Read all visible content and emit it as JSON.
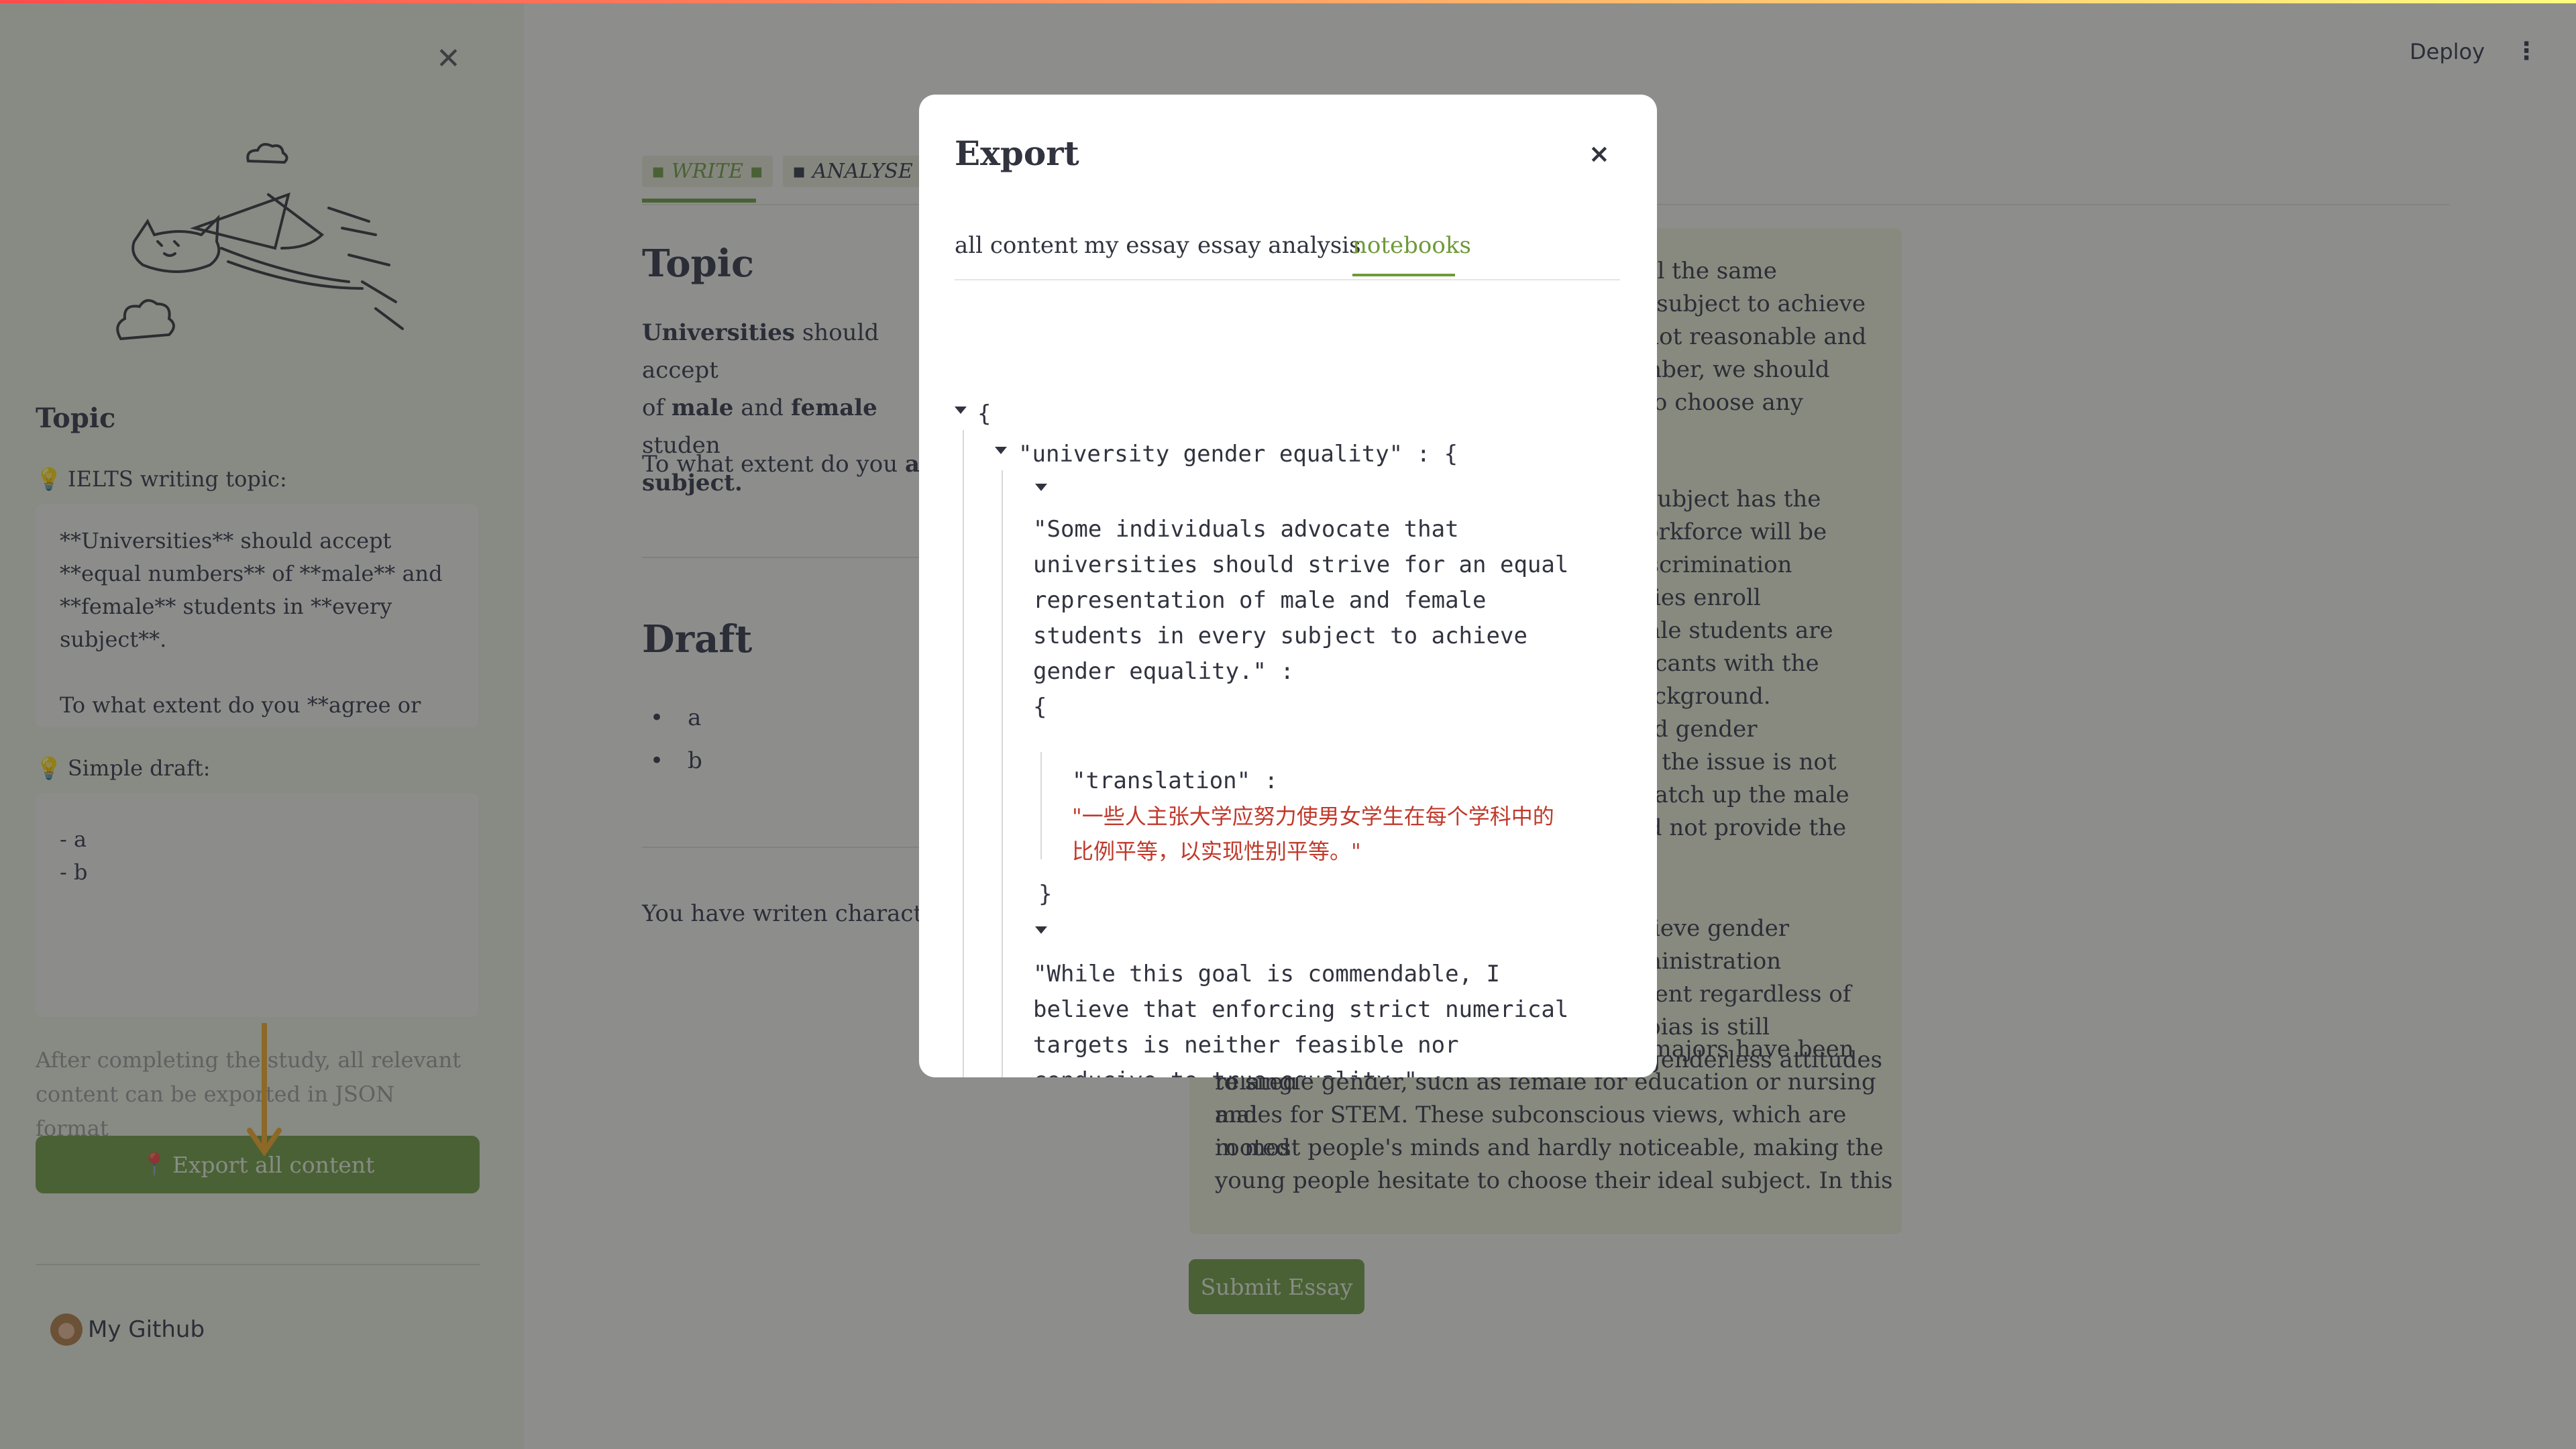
{
  "sidebar": {
    "close_icon": "close-icon",
    "topic_heading": "Topic",
    "topic_label": "IELTS writing topic:",
    "topic_text": "**Universities** should accept **equal numbers** of **male** and **female** students in **every subject**.\n\nTo what extent do you **agree or",
    "draft_label": "Simple draft:",
    "draft_text": "- a\n- b",
    "note": "After completing the study, all relevant content can be exported in JSON format",
    "export_button": "Export all content",
    "github_link": "My Github"
  },
  "header": {
    "deploy": "Deploy",
    "menu_icon": "⋮"
  },
  "main": {
    "tabs": [
      {
        "label": "WRITE",
        "active": true
      },
      {
        "label": "ANALYSE",
        "active": false
      }
    ],
    "topic_heading": "Topic",
    "topic_line1_a": "Universities",
    "topic_line1_b": " should accept",
    "topic_line2_a": "of ",
    "topic_line2_b": "male",
    "topic_line2_c": " and ",
    "topic_line2_d": "female",
    "topic_line2_e": " studen",
    "topic_line3": "subject.",
    "ask_a": "To what extent do you ",
    "ask_b": "agre",
    "draft_heading": "Draft",
    "draft_items": [
      "a",
      "b"
    ],
    "char_count": "You have writen characters",
    "essay_paragraphs": [
      [
        "roll the same",
        "ry subject to achieve",
        "s not reasonable and",
        "umber, we should",
        "s to choose any"
      ],
      [
        "y subject has the",
        "workforce will be",
        "discrimination",
        "sities enroll",
        " male students are",
        "plicants with the",
        "background.",
        "ned gender",
        "er, the issue is not",
        "t catch up the male",
        "uld not provide the"
      ],
      [
        "chieve gender",
        "dministration",
        "udent regardless of",
        "e bias is still",
        "e genderless attitudes"
      ],
      [
        "for every subject. For example, some majors have been related",
        "to single gender, such as female for education or nursing and",
        "males for STEM. These subconscious views, which are rooted",
        "in most people's minds and hardly noticeable, making the",
        "young people hesitate to choose their ideal subject. In this"
      ]
    ],
    "submit_button": "Submit Essay"
  },
  "modal": {
    "title": "Export",
    "close": "×",
    "tabs": [
      "all content",
      "my essay",
      "essay analysis",
      "notebooks"
    ],
    "active_tab": "notebooks",
    "json": {
      "open_brace": "{",
      "key_topic": "\"university gender equality\"",
      "colon_brace": ":",
      "brace": "{",
      "entry1": [
        "\"Some individuals advocate that",
        "universities should strive for an equal",
        "representation of male and female",
        "students in every subject to achieve",
        "gender equality.\""
      ],
      "colon": ":",
      "translation_key": "\"translation\"",
      "translation_value": [
        "\"一些人主张大学应努力使男女学生在每个学科中的",
        "比例平等，以实现性别平等。\""
      ],
      "close_brace": "}",
      "entry2": [
        "\"While this goal is commendable, I",
        "believe that enforcing strict numerical",
        "targets is neither feasible nor",
        "conducive to true equality.\""
      ]
    }
  },
  "colors": {
    "accent": "#6e9a3a",
    "translation": "#c0392b"
  }
}
